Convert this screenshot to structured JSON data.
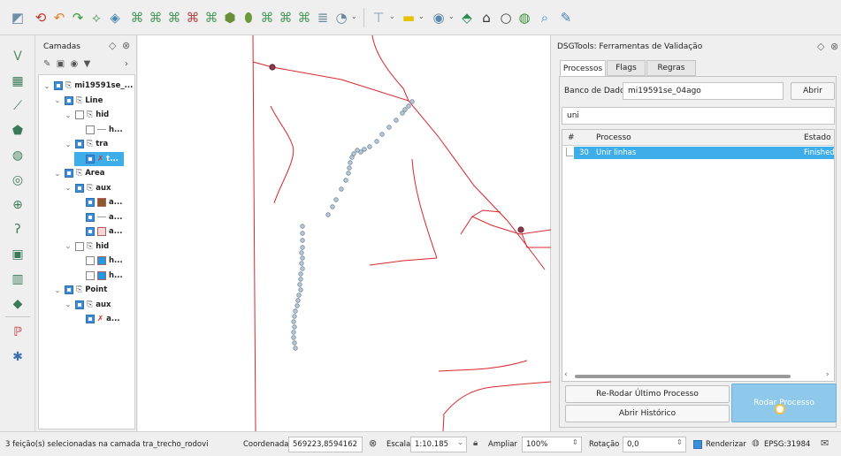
{
  "toolbar": {
    "icons": [
      "vector-tool-icon",
      "undo-red-icon",
      "redo-orange-icon",
      "redo-green-icon",
      "digitize-node-icon",
      "digitize-select-icon",
      "edit-node-icon",
      "merge-icon",
      "split-icon",
      "delete-feature-icon",
      "shape-a-icon",
      "shape-b-icon",
      "reshape-icon",
      "offset-icon",
      "rotate-icon",
      "align-icon",
      "snap-icon",
      "style-icon",
      "label-icon",
      "plugin-icon",
      "home-icon",
      "circle-icon",
      "globe-icon",
      "zoom-icon",
      "paint-icon"
    ]
  },
  "left_tools": {
    "icons": [
      "add-vector-icon",
      "add-raster-icon",
      "add-line-icon",
      "add-polygon-icon",
      "add-wms-icon",
      "add-wfs-icon",
      "add-text-icon",
      "add-spatialite-icon",
      "add-postgis-icon",
      "add-delimited-icon",
      "add-mesh-icon",
      "python-icon",
      "network-icon"
    ]
  },
  "layers_panel": {
    "title": "Camadas",
    "tree": [
      {
        "label": "mi19591se_...",
        "depth": 0,
        "bold": true,
        "checked": true,
        "expand": true,
        "kind": "group"
      },
      {
        "label": "Line",
        "depth": 1,
        "bold": true,
        "checked": true,
        "expand": true,
        "kind": "group"
      },
      {
        "label": "hid",
        "depth": 2,
        "bold": true,
        "checked": false,
        "expand": true,
        "kind": "group"
      },
      {
        "label": "h...",
        "depth": 3,
        "bold": true,
        "checked": false,
        "expand": false,
        "kind": "line-layer",
        "swatch": "#9a9a9a"
      },
      {
        "label": "tra",
        "depth": 2,
        "bold": true,
        "checked": true,
        "expand": true,
        "kind": "group"
      },
      {
        "label": "t...",
        "depth": 3,
        "bold": true,
        "checked": true,
        "expand": false,
        "kind": "selected-layer",
        "swatch": "#c13b3b"
      },
      {
        "label": "Area",
        "depth": 1,
        "bold": true,
        "checked": true,
        "expand": true,
        "kind": "group"
      },
      {
        "label": "aux",
        "depth": 2,
        "bold": true,
        "checked": true,
        "expand": true,
        "kind": "group"
      },
      {
        "label": "a...",
        "depth": 3,
        "bold": true,
        "checked": true,
        "expand": false,
        "kind": "poly-layer",
        "swatch": "#8b5a2b"
      },
      {
        "label": "a...",
        "depth": 3,
        "bold": true,
        "checked": true,
        "expand": false,
        "kind": "line-layer",
        "swatch": "#9a9a9a"
      },
      {
        "label": "a...",
        "depth": 3,
        "bold": true,
        "checked": true,
        "expand": false,
        "kind": "poly-layer",
        "swatch": "#f3d6d6"
      },
      {
        "label": "hid",
        "depth": 2,
        "bold": true,
        "checked": false,
        "expand": true,
        "kind": "group"
      },
      {
        "label": "h...",
        "depth": 3,
        "bold": true,
        "checked": false,
        "expand": false,
        "kind": "poly-layer",
        "swatch": "#1e9be6"
      },
      {
        "label": "h...",
        "depth": 3,
        "bold": true,
        "checked": false,
        "expand": false,
        "kind": "poly-layer",
        "swatch": "#1e9be6"
      },
      {
        "label": "Point",
        "depth": 1,
        "bold": true,
        "checked": true,
        "expand": true,
        "kind": "group"
      },
      {
        "label": "aux",
        "depth": 2,
        "bold": true,
        "checked": true,
        "expand": true,
        "kind": "group"
      },
      {
        "label": "a...",
        "depth": 3,
        "bold": true,
        "checked": true,
        "expand": false,
        "kind": "point-layer",
        "swatch": "#d02a2a"
      }
    ]
  },
  "dsg": {
    "title": "DSGTools: Ferramentas de Validação",
    "tabs": [
      "Processos",
      "Flags",
      "Regras"
    ],
    "db_label": "Banco de Dados",
    "db_value": "mi19591se_04ago",
    "open_button": "Abrir",
    "filter_value": "uni",
    "table": {
      "headers": [
        "#",
        "Processo",
        "Estado"
      ],
      "rows": [
        {
          "num": "30",
          "process": "Unir linhas",
          "status": "Finished"
        }
      ]
    },
    "rerun_button": "Re-Rodar Último Processo",
    "history_button": "Abrir Histórico",
    "run_button": "Rodar Processo"
  },
  "status": {
    "message": "3 feição(s) selecionadas na camada tra_trecho_rodovi",
    "coord_label": "Coordenada",
    "coord_value": "569223,8594162",
    "scale_label": "Escala",
    "scale_value": "1:10.185",
    "magnifier_label": "Ampliar",
    "magnifier_value": "100%",
    "rotation_label": "Rotação",
    "rotation_value": "0,0",
    "render_label": "Renderizar",
    "crs": "EPSG:31984"
  },
  "colors": {
    "accent": "#3d8ed9",
    "selected_row": "#3daee9",
    "road_red": "#d9262b",
    "vertex": "#9fb3c3"
  }
}
